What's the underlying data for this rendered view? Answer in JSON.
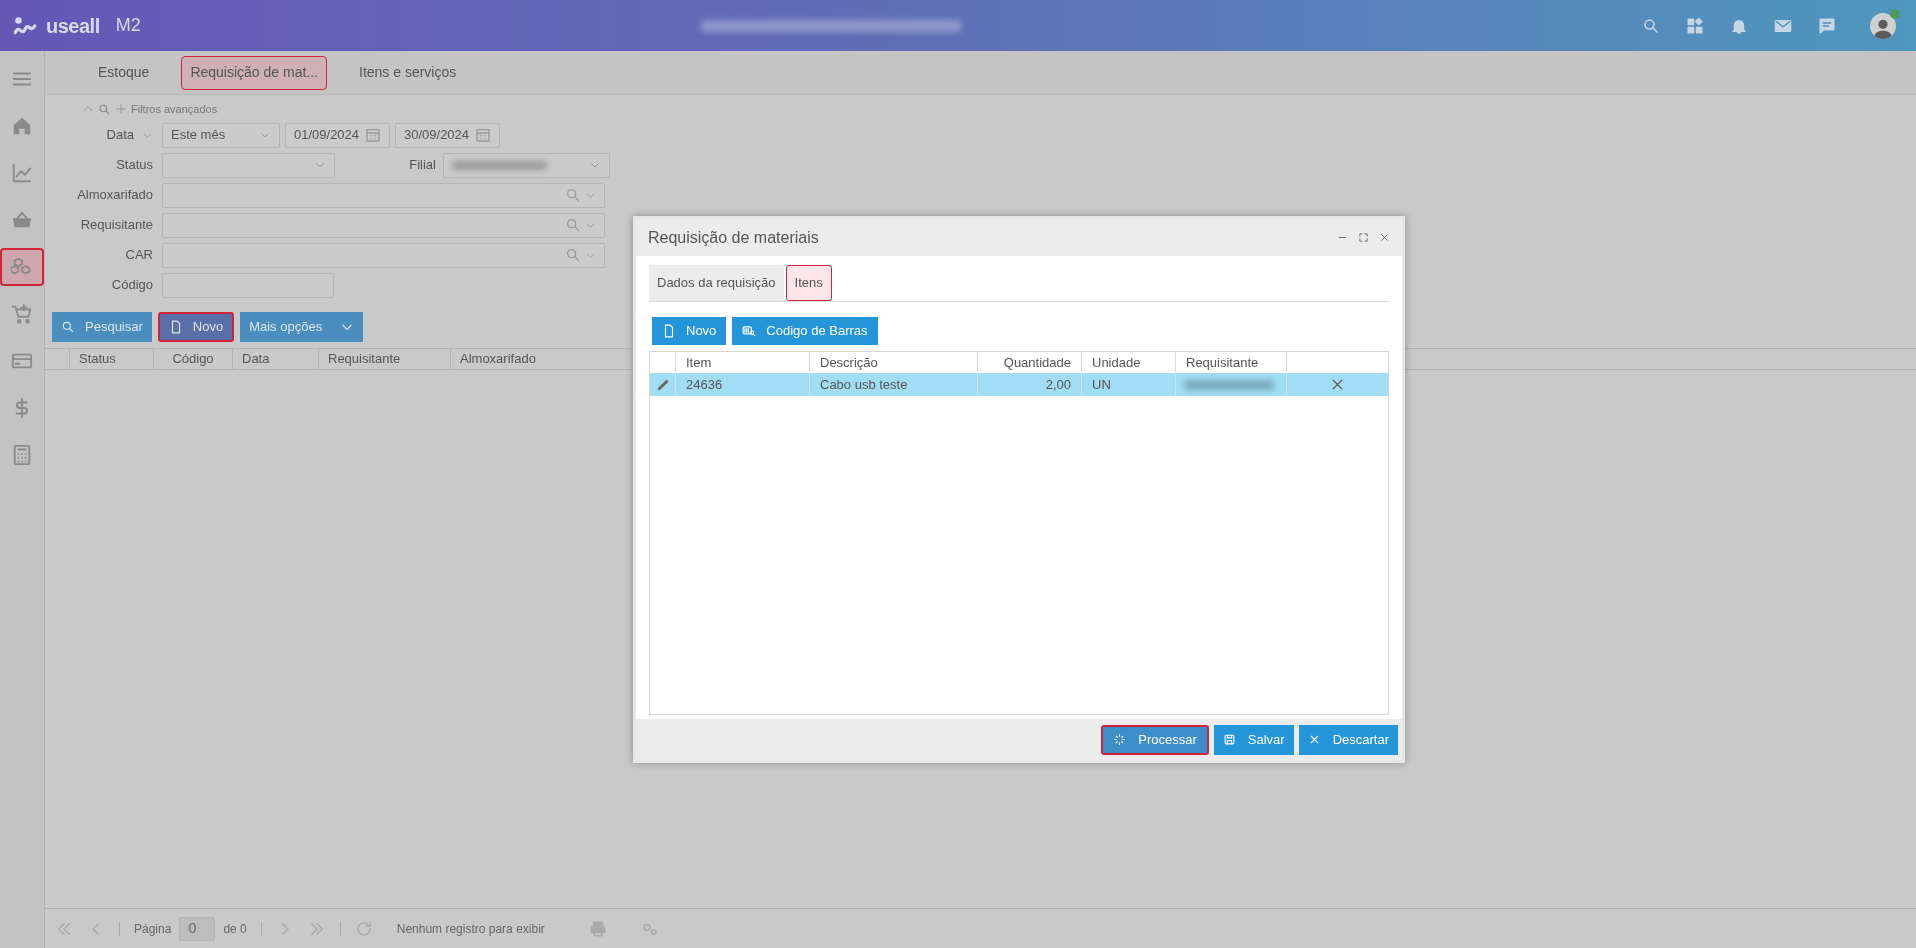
{
  "header": {
    "logo": "useall",
    "product": "M2"
  },
  "sidebar": {
    "items": [
      {
        "kind": "menu",
        "highlighted": false
      },
      {
        "kind": "home",
        "highlighted": false
      },
      {
        "kind": "chart",
        "highlighted": false
      },
      {
        "kind": "basket",
        "highlighted": false
      },
      {
        "kind": "boxes",
        "highlighted": true
      },
      {
        "kind": "cart",
        "highlighted": false
      },
      {
        "kind": "card",
        "highlighted": false
      },
      {
        "kind": "dollar",
        "highlighted": false
      },
      {
        "kind": "calculator",
        "highlighted": false
      }
    ]
  },
  "tabs": [
    {
      "label": "Estoque",
      "selected": false
    },
    {
      "label": "Requisição de mat...",
      "selected": true
    },
    {
      "label": "Itens e serviços",
      "selected": false
    }
  ],
  "filters": {
    "advanced_label": "Filtros avançados",
    "date": {
      "label": "Data",
      "period": "Este mês",
      "from": "01/09/2024",
      "to": "30/09/2024"
    },
    "status_label": "Status",
    "branch_label": "Filial",
    "lookups": [
      {
        "label": "Almoxarifado"
      },
      {
        "label": "Requisitante"
      },
      {
        "label": "CAR"
      }
    ],
    "code_label": "Código"
  },
  "actions": [
    {
      "label": "Pesquisar",
      "kind": "search",
      "highlighted": false
    },
    {
      "label": "Novo",
      "kind": "new",
      "highlighted": true
    },
    {
      "label": "Mais opções",
      "kind": "dropdown",
      "highlighted": false
    }
  ],
  "grid": {
    "columns": [
      "Status",
      "Código",
      "Data",
      "Requisitante",
      "Almoxarifado"
    ]
  },
  "pager": {
    "page_label": "Página",
    "page": "0",
    "of_label": "de 0",
    "message": "Nenhum registro para exibir"
  },
  "dialog": {
    "title": "Requisição de materiais",
    "tabs": [
      {
        "label": "Dados da requisição",
        "selected": false
      },
      {
        "label": "Itens",
        "selected": true
      }
    ],
    "buttons": [
      {
        "label": "Novo",
        "kind": "new"
      },
      {
        "label": "Codigo de Barras",
        "kind": "barcode"
      }
    ],
    "columns": [
      "Item",
      "Descrição",
      "Quantidade",
      "Unidade",
      "Requisitante"
    ],
    "rows": [
      {
        "item": "24636",
        "description": "Cabo usb teste",
        "quantity": "2,00",
        "unit": "UN",
        "selected": true
      }
    ],
    "footer_buttons": [
      {
        "label": "Processar",
        "kind": "process",
        "highlighted": true
      },
      {
        "label": "Salvar",
        "kind": "save",
        "highlighted": false
      },
      {
        "label": "Descartar",
        "kind": "discard",
        "highlighted": false
      }
    ]
  }
}
